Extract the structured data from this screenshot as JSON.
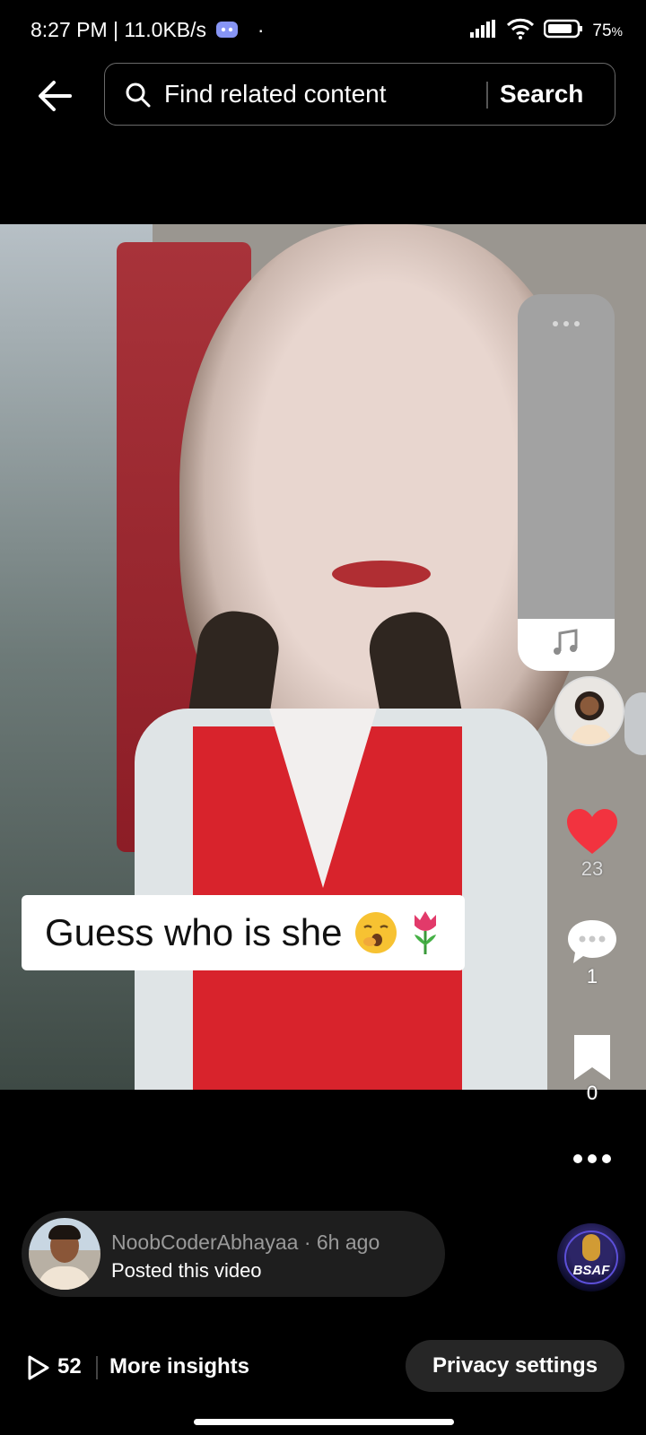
{
  "status_bar": {
    "time_speed": "8:27 PM | 11.0KB/s",
    "battery": "75"
  },
  "search": {
    "placeholder": "Find related content",
    "button_label": "Search"
  },
  "video": {
    "caption": "Guess who is she"
  },
  "actions": {
    "likes": "23",
    "comments": "1",
    "saves": "0"
  },
  "post": {
    "username": "NoobCoderAbhayaa",
    "age": "6h ago",
    "subtitle": "Posted this video"
  },
  "brand": {
    "logo_text": "BSAF"
  },
  "bottom_bar": {
    "views": "52",
    "insights_label": "More insights",
    "privacy_label": "Privacy settings"
  },
  "colors": {
    "like": "#f2333f",
    "background": "#000000",
    "pill": "#1e1e1e"
  },
  "icons": [
    "discord-icon",
    "signal-icon",
    "wifi-icon",
    "battery-icon",
    "back-arrow-icon",
    "search-icon",
    "music-note-icon",
    "heart-icon",
    "comment-icon",
    "bookmark-icon",
    "more-icon",
    "play-icon"
  ]
}
